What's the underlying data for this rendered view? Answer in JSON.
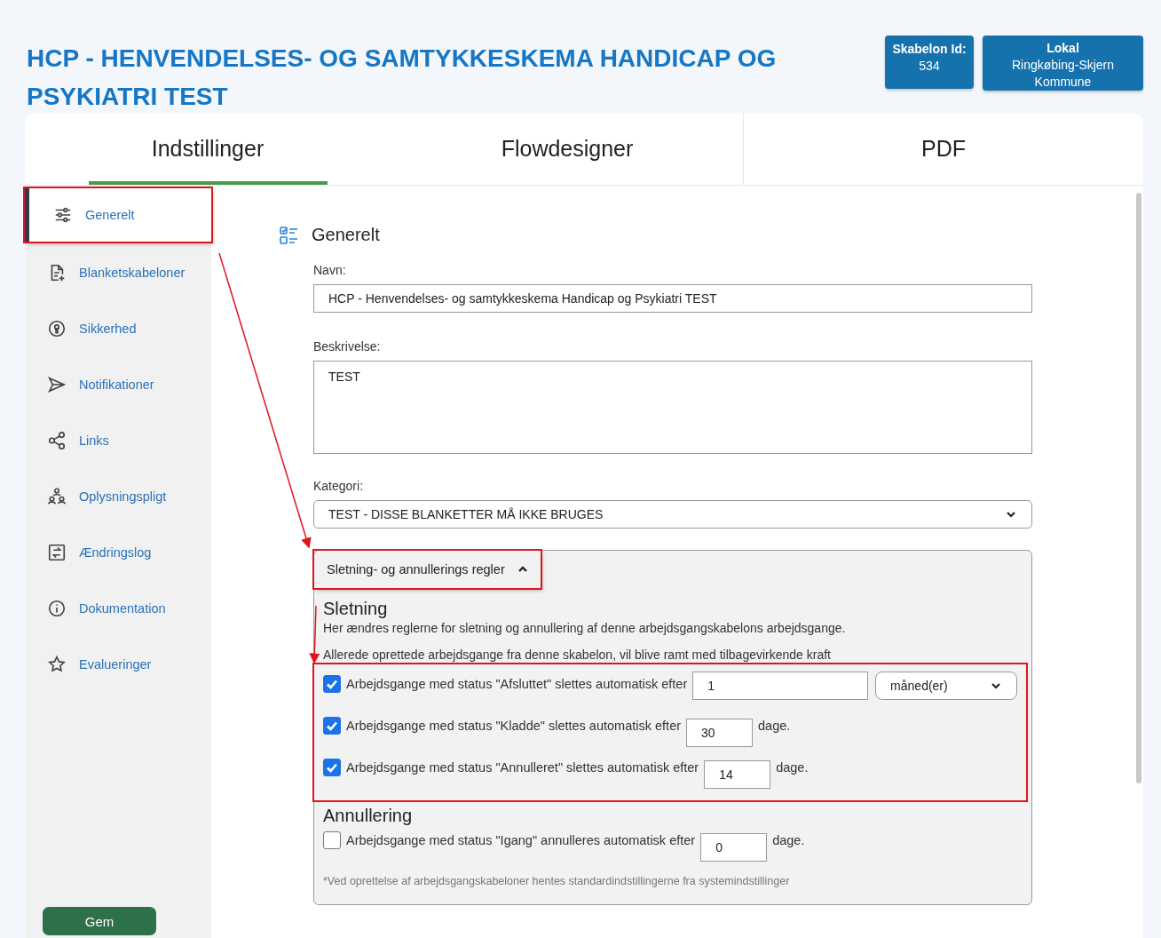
{
  "header": {
    "title": "HCP - HENVENDELSES- OG SAMTYKKESKEMA HANDICAP OG PSYKIATRI TEST",
    "badges": [
      {
        "label": "Skabelon Id:",
        "value": "534"
      },
      {
        "label": "Lokal",
        "value": "Ringkøbing-Skjern Kommune"
      }
    ]
  },
  "tabs": [
    {
      "label": "Indstillinger",
      "selected": true
    },
    {
      "label": "Flowdesigner",
      "selected": false
    },
    {
      "label": "PDF",
      "selected": false
    }
  ],
  "sidebar": {
    "items": [
      {
        "label": "Generelt",
        "selected": true,
        "highlighted": true
      },
      {
        "label": "Blanketskabeloner",
        "selected": false,
        "highlighted": false
      },
      {
        "label": "Sikkerhed",
        "selected": false,
        "highlighted": false
      },
      {
        "label": "Notifikationer",
        "selected": false,
        "highlighted": false
      },
      {
        "label": "Links",
        "selected": false,
        "highlighted": false
      },
      {
        "label": "Oplysningspligt",
        "selected": false,
        "highlighted": false
      },
      {
        "label": "Ændringslog",
        "selected": false,
        "highlighted": false
      },
      {
        "label": "Dokumentation",
        "selected": false,
        "highlighted": false
      },
      {
        "label": "Evalueringer",
        "selected": false,
        "highlighted": false
      }
    ],
    "save_button": "Gem"
  },
  "section": {
    "title": "Generelt",
    "name": {
      "label": "Navn:",
      "value": "HCP - Henvendelses- og samtykkeskema Handicap og Psykiatri TEST"
    },
    "description": {
      "label": "Beskrivelse:",
      "value": "TEST"
    },
    "category": {
      "label": "Kategori:",
      "value": "TEST - DISSE BLANKETTER MÅ IKKE BRUGES"
    },
    "rules": {
      "toggle": "Sletning- og annullerings regler",
      "expanded": true,
      "toggle_highlighted": true,
      "deletion": {
        "heading": "Sletning",
        "intro": "Her ændres reglerne for sletning og annullering af denne arbejdsgangskabelons arbejdsgange.",
        "note": "Allerede oprettede arbejdsgange fra denne skabelon, vil blive ramt med tilbagevirkende kraft",
        "highlighted": true,
        "rows": [
          {
            "kind": "select",
            "checked": true,
            "text": "Arbejdsgange med status \"Afsluttet\" slettes automatisk efter",
            "value": "1",
            "unit": "måned(er)"
          },
          {
            "kind": "text",
            "checked": true,
            "text": "Arbejdsgange med status \"Kladde\" slettes automatisk efter",
            "value": "30",
            "unit": "dage."
          },
          {
            "kind": "text",
            "checked": true,
            "text": "Arbejdsgange med status \"Annulleret\" slettes automatisk efter",
            "value": "14",
            "unit": "dage."
          }
        ]
      },
      "cancellation": {
        "heading": "Annullering",
        "rows": [
          {
            "kind": "text",
            "checked": false,
            "text": "Arbejdsgange med status \"Igang\" annulleres automatisk efter",
            "value": "0",
            "unit": "dage."
          }
        ]
      },
      "footnote": "*Ved oprettelse af arbejdsgangskabeloner hentes standardindstillingerne fra systemindstillinger"
    }
  }
}
